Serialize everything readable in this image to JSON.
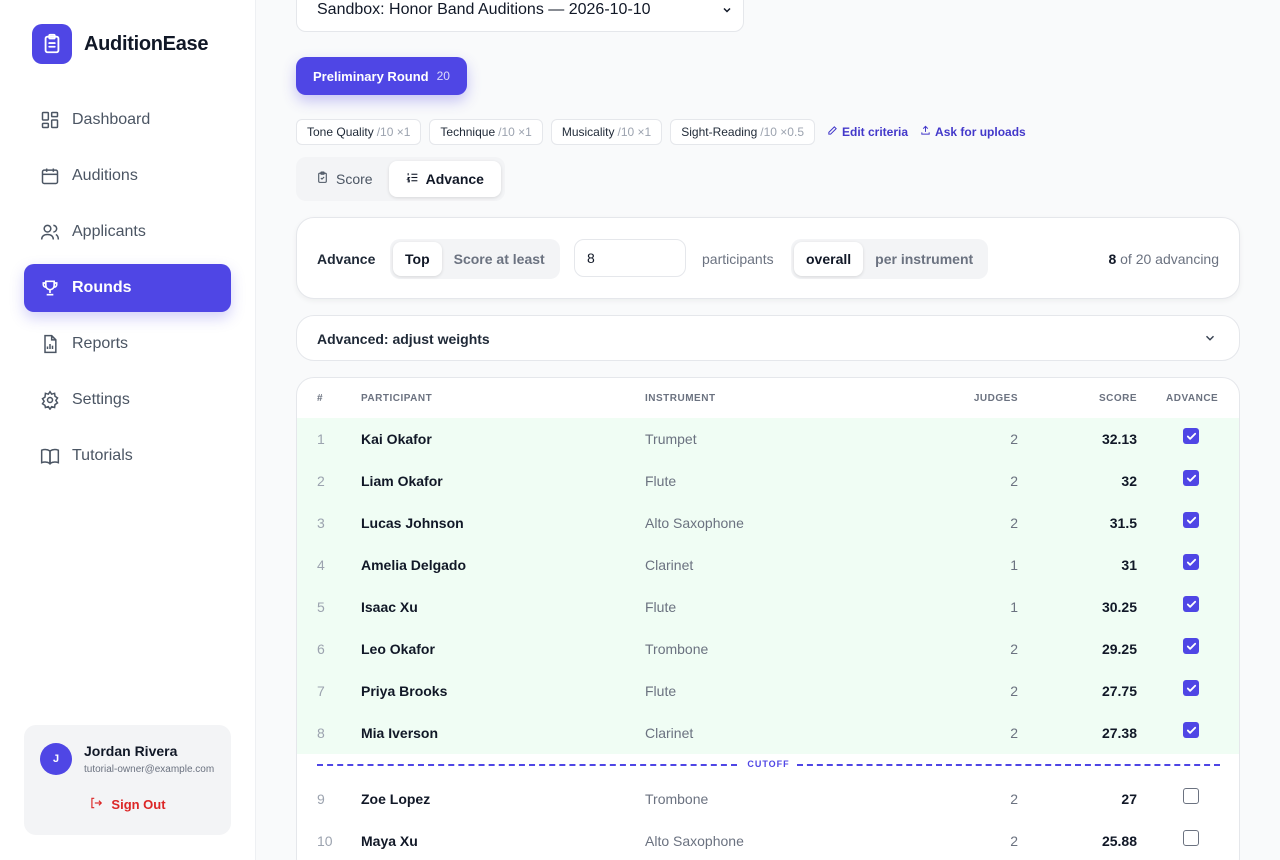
{
  "app": {
    "name": "AuditionEase",
    "logo_icon": "clipboard-icon",
    "accent": "#4f46e5"
  },
  "sidebar": {
    "items": [
      {
        "label": "Dashboard",
        "icon": "dashboard-icon"
      },
      {
        "label": "Auditions",
        "icon": "calendar-icon"
      },
      {
        "label": "Applicants",
        "icon": "users-icon"
      },
      {
        "label": "Rounds",
        "icon": "trophy-icon",
        "active": true
      },
      {
        "label": "Reports",
        "icon": "report-icon"
      },
      {
        "label": "Settings",
        "icon": "gear-icon"
      },
      {
        "label": "Tutorials",
        "icon": "book-icon"
      }
    ]
  },
  "user": {
    "initial": "J",
    "name": "Jordan Rivera",
    "email": "tutorial-owner@example.com",
    "signout_label": "Sign Out"
  },
  "audition_select": {
    "value": "Sandbox: Honor Band Auditions — 2026-10-10"
  },
  "round_tab": {
    "label": "Preliminary Round",
    "count": "20"
  },
  "criteria": [
    {
      "name": "Tone Quality",
      "weight": "/10 ×1"
    },
    {
      "name": "Technique",
      "weight": "/10 ×1"
    },
    {
      "name": "Musicality",
      "weight": "/10 ×1"
    },
    {
      "name": "Sight-Reading",
      "weight": "/10 ×0.5"
    }
  ],
  "links": {
    "edit_criteria": "Edit criteria",
    "ask_uploads": "Ask for uploads"
  },
  "view_tabs": {
    "score": "Score",
    "advance": "Advance"
  },
  "advance": {
    "label": "Advance",
    "mode_top": "Top",
    "mode_score": "Score at least",
    "count_value": "8",
    "participants_label": "participants",
    "scope_overall": "overall",
    "scope_per_instrument": "per instrument",
    "advancing_count": "8",
    "advancing_suffix": "of 20 advancing"
  },
  "weights": {
    "label": "Advanced: adjust weights"
  },
  "table": {
    "headers": {
      "num": "#",
      "participant": "PARTICIPANT",
      "instrument": "INSTRUMENT",
      "judges": "JUDGES",
      "score": "SCORE",
      "advance": "ADVANCE"
    },
    "cutoff_label": "CUTOFF",
    "rows": [
      {
        "num": "1",
        "name": "Kai Okafor",
        "instrument": "Trumpet",
        "judges": "2",
        "score": "32.13",
        "advance": true
      },
      {
        "num": "2",
        "name": "Liam Okafor",
        "instrument": "Flute",
        "judges": "2",
        "score": "32",
        "advance": true
      },
      {
        "num": "3",
        "name": "Lucas Johnson",
        "instrument": "Alto Saxophone",
        "judges": "2",
        "score": "31.5",
        "advance": true
      },
      {
        "num": "4",
        "name": "Amelia Delgado",
        "instrument": "Clarinet",
        "judges": "1",
        "score": "31",
        "advance": true
      },
      {
        "num": "5",
        "name": "Isaac Xu",
        "instrument": "Flute",
        "judges": "1",
        "score": "30.25",
        "advance": true
      },
      {
        "num": "6",
        "name": "Leo Okafor",
        "instrument": "Trombone",
        "judges": "2",
        "score": "29.25",
        "advance": true
      },
      {
        "num": "7",
        "name": "Priya Brooks",
        "instrument": "Flute",
        "judges": "2",
        "score": "27.75",
        "advance": true
      },
      {
        "num": "8",
        "name": "Mia Iverson",
        "instrument": "Clarinet",
        "judges": "2",
        "score": "27.38",
        "advance": true
      },
      {
        "num": "9",
        "name": "Zoe Lopez",
        "instrument": "Trombone",
        "judges": "2",
        "score": "27",
        "advance": false
      },
      {
        "num": "10",
        "name": "Maya Xu",
        "instrument": "Alto Saxophone",
        "judges": "2",
        "score": "25.88",
        "advance": false
      }
    ]
  }
}
